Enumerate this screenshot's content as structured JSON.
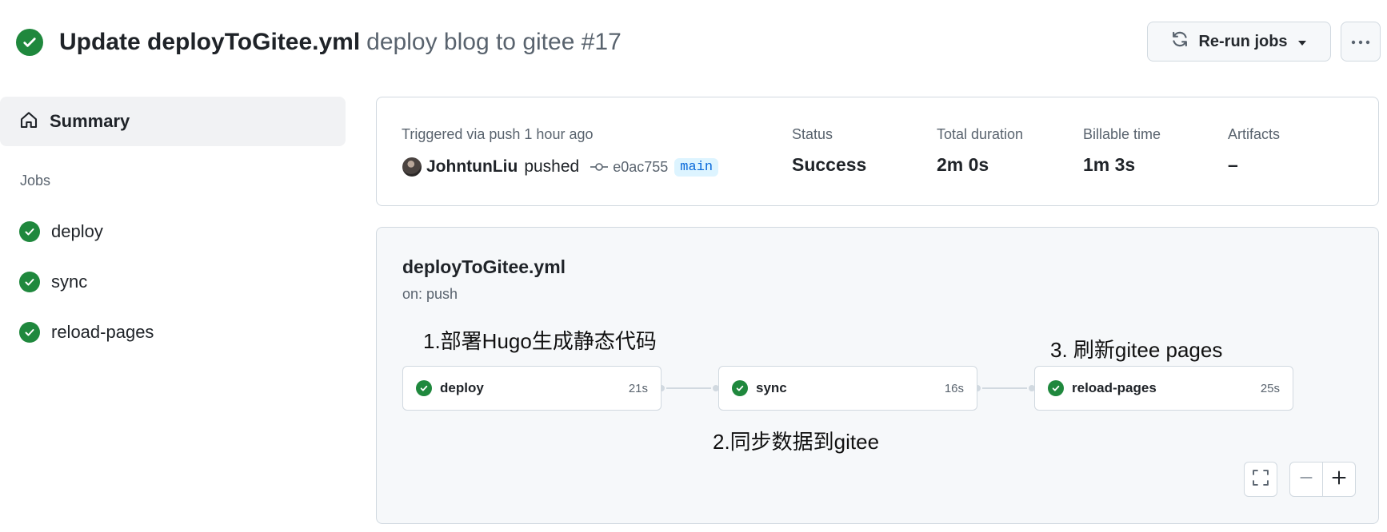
{
  "header": {
    "commit_message": "Update deployToGitee.yml",
    "run_name": "deploy blog to gitee #17",
    "rerun_label": "Re-run jobs"
  },
  "sidebar": {
    "summary_label": "Summary",
    "jobs_heading": "Jobs",
    "jobs": [
      {
        "label": "deploy",
        "status": "success"
      },
      {
        "label": "sync",
        "status": "success"
      },
      {
        "label": "reload-pages",
        "status": "success"
      }
    ]
  },
  "summary": {
    "triggered_text": "Triggered via push 1 hour ago",
    "actor": "JohntunLiu",
    "action": "pushed",
    "commit_sha": "e0ac755",
    "branch": "main",
    "stats": [
      {
        "label": "Status",
        "value": "Success"
      },
      {
        "label": "Total duration",
        "value": "2m 0s"
      },
      {
        "label": "Billable time",
        "value": "1m 3s"
      },
      {
        "label": "Artifacts",
        "value": "–"
      }
    ]
  },
  "workflow": {
    "file": "deployToGitee.yml",
    "trigger": "on: push",
    "jobs": [
      {
        "name": "deploy",
        "duration": "21s"
      },
      {
        "name": "sync",
        "duration": "16s"
      },
      {
        "name": "reload-pages",
        "duration": "25s"
      }
    ],
    "annotations": [
      "1.部署Hugo生成静态代码",
      "2.同步数据到gitee",
      "3. 刷新gitee pages"
    ]
  },
  "colors": {
    "success": "#1f883d",
    "link": "#0969da",
    "muted": "#59636e",
    "border": "#d1d9e0"
  }
}
